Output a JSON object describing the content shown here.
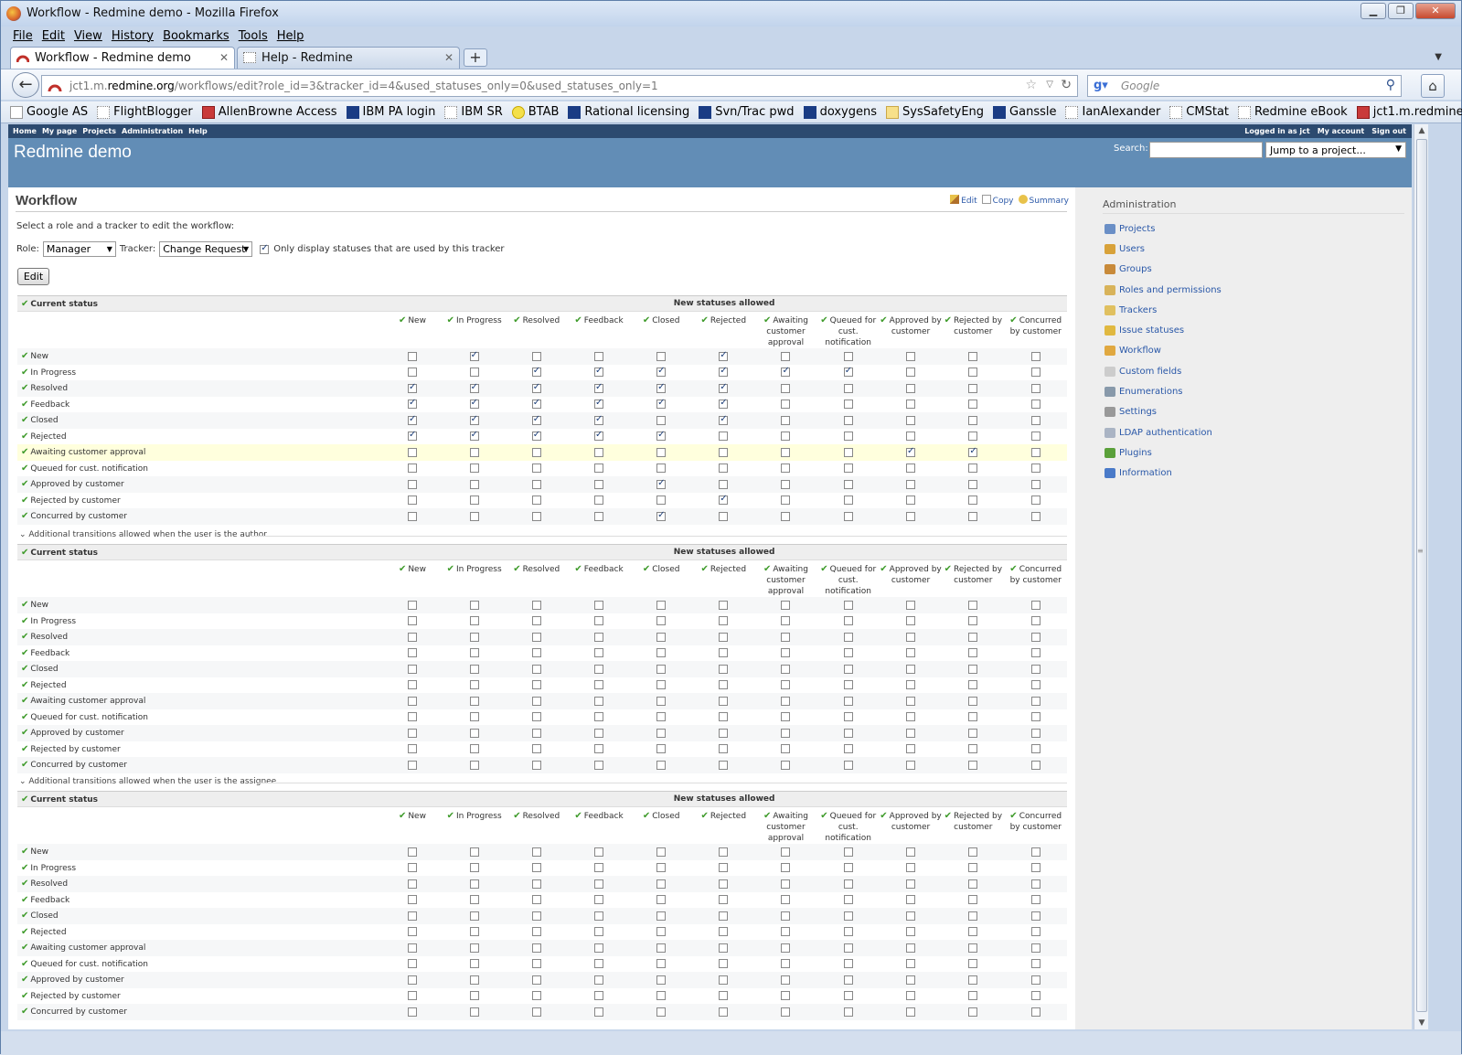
{
  "window": {
    "title": "Workflow - Redmine demo - Mozilla Firefox"
  },
  "menu": [
    "File",
    "Edit",
    "View",
    "History",
    "Bookmarks",
    "Tools",
    "Help"
  ],
  "tabs": [
    {
      "label": "Workflow - Redmine demo",
      "active": true
    },
    {
      "label": "Help - Redmine",
      "active": false
    }
  ],
  "nav": {
    "url_prefix": "jct1.m.",
    "url_domain": "redmine.org",
    "url_path": "/workflows/edit?role_id=3&tracker_id=4&used_statuses_only=0&used_statuses_only=1",
    "search_placeholder": "Google"
  },
  "bookmarks": [
    {
      "label": "Google AS",
      "icon": "google-icon"
    },
    {
      "label": "FlightBlogger",
      "icon": "page-icon"
    },
    {
      "label": "AllenBrowne Access",
      "icon": "edit-icon"
    },
    {
      "label": "IBM PA login",
      "icon": "ibm-icon"
    },
    {
      "label": "IBM SR",
      "icon": "page-icon"
    },
    {
      "label": "BTAB",
      "icon": "circle-icon"
    },
    {
      "label": "Rational licensing",
      "icon": "ibm-icon"
    },
    {
      "label": "Svn/Trac pwd",
      "icon": "ibm-icon"
    },
    {
      "label": "doxygens",
      "icon": "ibm-icon"
    },
    {
      "label": "SysSafetyEng",
      "icon": "folder-icon"
    },
    {
      "label": "Ganssle",
      "icon": "g-icon"
    },
    {
      "label": "IanAlexander",
      "icon": "page-icon"
    },
    {
      "label": "CMStat",
      "icon": "page-icon"
    },
    {
      "label": "Redmine eBook",
      "icon": "page-icon"
    },
    {
      "label": "jct1.m.redmine.org",
      "icon": "redmine-icon"
    }
  ],
  "topmenu": {
    "left": [
      "Home",
      "My page",
      "Projects",
      "Administration",
      "Help"
    ],
    "logged": "Logged in as jct",
    "right": [
      "My account",
      "Sign out"
    ]
  },
  "header": {
    "title": "Redmine demo",
    "search_label": "Search:",
    "jump": "Jump to a project..."
  },
  "content": {
    "title": "Workflow",
    "actions": [
      "Edit",
      "Copy",
      "Summary"
    ],
    "description": "Select a role and a tracker to edit the workflow:",
    "role_label": "Role:",
    "role_value": "Manager",
    "tracker_label": "Tracker:",
    "tracker_value": "Change Request",
    "only_used_label": "Only display statuses that are used by this tracker",
    "only_used_checked": true,
    "edit_button": "Edit",
    "current_status": "Current status",
    "new_statuses": "New statuses allowed",
    "author_section": "Additional transitions allowed when the user is the author",
    "assignee_section": "Additional transitions allowed when the user is the assignee",
    "statuses": [
      "New",
      "In Progress",
      "Resolved",
      "Feedback",
      "Closed",
      "Rejected",
      "Awaiting customer approval",
      "Queued for cust. notification",
      "Approved by customer",
      "Rejected by customer",
      "Concurred by customer"
    ],
    "table1_columns": [
      "New",
      "In Progress",
      "Resolved",
      "Feedback",
      "Closed",
      "Rejected",
      "Awaiting customer approval",
      "Queued for cust. notification",
      "Approved by customer",
      "Rejected by customer",
      "Concurred by customer"
    ],
    "table2_columns": [
      "New",
      "In Progress",
      "Resolved",
      "Feedback",
      "Closed",
      "Rejected",
      "Awaiting customer approval",
      "Queued for cust. notification",
      "Approved by customer",
      "Rejected by customer",
      "Concurred by customer"
    ],
    "highlight_row": 6,
    "matrix": [
      [
        0,
        1,
        0,
        0,
        0,
        1,
        0,
        0,
        0,
        0,
        0
      ],
      [
        0,
        0,
        1,
        1,
        1,
        1,
        1,
        1,
        0,
        0,
        0
      ],
      [
        1,
        1,
        1,
        1,
        1,
        1,
        0,
        0,
        0,
        0,
        0
      ],
      [
        1,
        1,
        1,
        1,
        1,
        1,
        0,
        0,
        0,
        0,
        0
      ],
      [
        1,
        1,
        1,
        1,
        0,
        1,
        0,
        0,
        0,
        0,
        0
      ],
      [
        1,
        1,
        1,
        1,
        1,
        0,
        0,
        0,
        0,
        0,
        0
      ],
      [
        0,
        0,
        0,
        0,
        0,
        0,
        0,
        0,
        1,
        1,
        0
      ],
      [
        0,
        0,
        0,
        0,
        0,
        0,
        0,
        0,
        0,
        0,
        0
      ],
      [
        0,
        0,
        0,
        0,
        1,
        0,
        0,
        0,
        0,
        0,
        0
      ],
      [
        0,
        0,
        0,
        0,
        0,
        1,
        0,
        0,
        0,
        0,
        0
      ],
      [
        0,
        0,
        0,
        0,
        1,
        0,
        0,
        0,
        0,
        0,
        0
      ]
    ]
  },
  "sidebar": {
    "title": "Administration",
    "items": [
      {
        "label": "Projects",
        "color": "#6a8fc6"
      },
      {
        "label": "Users",
        "color": "#d8a23a"
      },
      {
        "label": "Groups",
        "color": "#c88a3a"
      },
      {
        "label": "Roles and permissions",
        "color": "#d8b35a"
      },
      {
        "label": "Trackers",
        "color": "#e0c060"
      },
      {
        "label": "Issue statuses",
        "color": "#e0b840"
      },
      {
        "label": "Workflow",
        "color": "#e0a840"
      },
      {
        "label": "Custom fields",
        "color": "#cccccc"
      },
      {
        "label": "Enumerations",
        "color": "#8899aa"
      },
      {
        "label": "Settings",
        "color": "#999999"
      },
      {
        "label": "LDAP authentication",
        "color": "#aab4c4"
      },
      {
        "label": "Plugins",
        "color": "#5aa03a"
      },
      {
        "label": "Information",
        "color": "#4a7ac8"
      }
    ]
  }
}
